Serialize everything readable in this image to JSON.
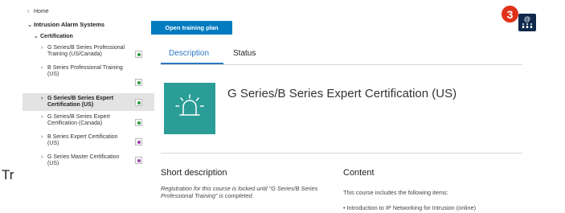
{
  "sidebar": {
    "home": "Home",
    "section": "Intrusion Alarm Systems",
    "certification": "Certification",
    "items": [
      {
        "line1": "G Series/B Series Professional",
        "line2": "Training (US/Canada)",
        "status_color": "#2e9c3e"
      },
      {
        "line1": "B Series Professional Training",
        "line2": "(US)",
        "status_color": "#2e9c3e"
      },
      {
        "line1": "G Series/B Series Expert",
        "line2": "Certification (US)",
        "status_color": "#2e9c3e"
      },
      {
        "line1": "G Series/B Series Expert",
        "line2": "Certification (Canada)",
        "status_color": "#2e9c3e"
      },
      {
        "line1": "B Series Expert Certification",
        "line2": "(US)",
        "status_color": "#9b3fa8"
      },
      {
        "line1": "G Series Master Certification",
        "line2": "(US)",
        "status_color": "#9b3fa8"
      }
    ],
    "selected_index": 2,
    "partial_text": "Tr"
  },
  "main": {
    "open_button": "Open training plan",
    "tabs": [
      "Description",
      "Status"
    ],
    "active_tab": "Description",
    "course_title": "G Series/B Series Expert Certification (US)",
    "course_icon": "alarm-beacon-icon",
    "short_description_heading": "Short description",
    "short_description_text": "Registration for this course is locked until \"G Series/B Series Professional Training\" is completed.",
    "content_heading": "Content",
    "content_intro": "This course includes the following items:",
    "content_items": [
      "Introduction to IP Networking for Intrusion (online)"
    ]
  },
  "overlay": {
    "step_badge": "3",
    "app_icon": "email-at-icon",
    "app_icon_glyph": "@"
  },
  "colors": {
    "accent_blue": "#007bc0",
    "tab_blue": "#2a78c1",
    "teal": "#2a9d96",
    "badge_red": "#e0321b",
    "icon_navy": "#0f2a4c"
  }
}
